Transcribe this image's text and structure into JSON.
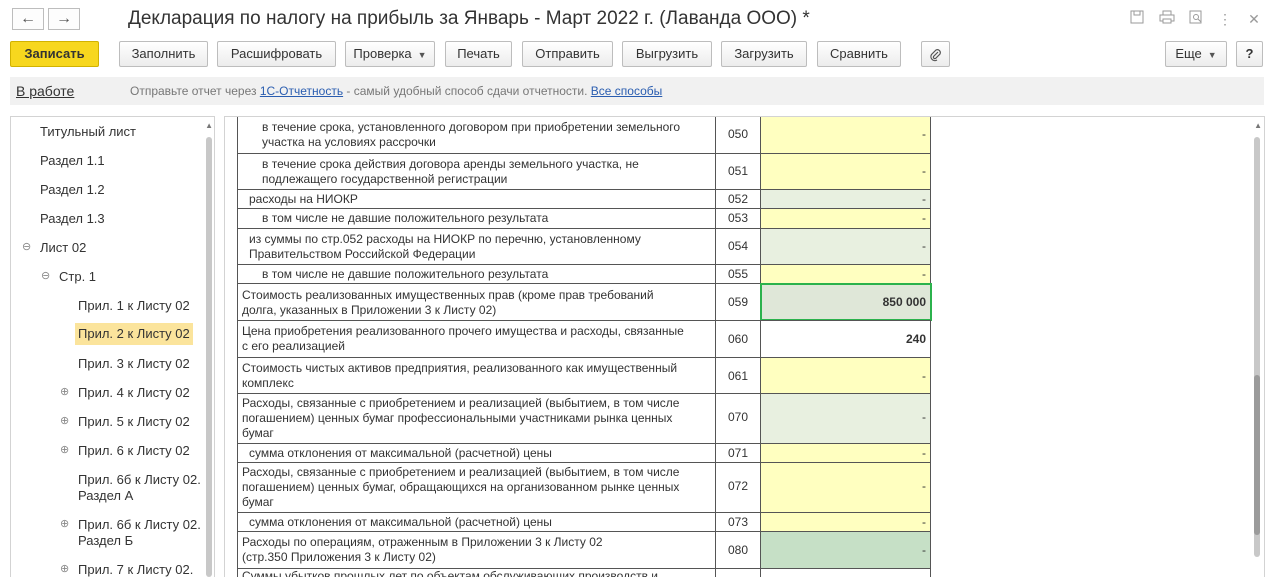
{
  "window": {
    "title": "Декларация по налогу на прибыль за Январь - Март 2022 г. (Лаванда ООО) *",
    "back_icon": "←",
    "forward_icon": "→"
  },
  "toolbar": {
    "save": "Записать",
    "fill": "Заполнить",
    "decode": "Расшифровать",
    "check": "Проверка",
    "print": "Печать",
    "send": "Отправить",
    "export": "Выгрузить",
    "import": "Загрузить",
    "compare": "Сравнить",
    "more": "Еще",
    "help": "?"
  },
  "infobar": {
    "status": "В работе",
    "text_before": "Отправьте отчет через ",
    "link1": "1С-Отчетность",
    "text_after": " - самый удобный способ сдачи отчетности. ",
    "link2": "Все способы"
  },
  "tree": [
    {
      "label": "Титульный лист"
    },
    {
      "label": "Раздел 1.1"
    },
    {
      "label": "Раздел 1.2"
    },
    {
      "label": "Раздел 1.3"
    },
    {
      "label": "Лист 02"
    },
    {
      "label": "Стр. 1"
    },
    {
      "label": "Прил. 1 к Листу 02"
    },
    {
      "label": "Прил. 2 к Листу 02"
    },
    {
      "label": "Прил. 3 к Листу 02"
    },
    {
      "label": "Прил. 4 к Листу 02"
    },
    {
      "label": "Прил. 5 к Листу 02"
    },
    {
      "label": "Прил. 6 к Листу 02"
    },
    {
      "label": "Прил. 6б к Листу 02.",
      "label2": "Раздел А"
    },
    {
      "label": "Прил. 6б к Листу 02.",
      "label2": "Раздел Б"
    },
    {
      "label": "Прил. 7 к Листу 02."
    }
  ],
  "table": {
    "rows": [
      {
        "l1": "в течение срока, установленного договором при приобретении земельного",
        "l2": "участка на условиях рассрочки",
        "code": "050",
        "value": "-"
      },
      {
        "l1": "в течение срока действия договора аренды земельного участка, не",
        "l2": "подлежащего государственной регистрации",
        "code": "051",
        "value": "-"
      },
      {
        "l1": "расходы на НИОКР",
        "code": "052",
        "value": "-"
      },
      {
        "l1": "в том числе не давшие положительного результата",
        "code": "053",
        "value": "-"
      },
      {
        "l1": "из суммы по стр.052 расходы на НИОКР по перечню, установленному",
        "l2": "Правительством Российской Федерации",
        "code": "054",
        "value": "-"
      },
      {
        "l1": "в том числе не давшие положительного результата",
        "code": "055",
        "value": "-"
      },
      {
        "l1": "Стоимость реализованных имущественных прав (кроме прав требований",
        "l2": "долга, указанных в Приложении 3 к Листу 02)",
        "code": "059",
        "value": "850 000"
      },
      {
        "l1": "Цена приобретения реализованного прочего имущества и расходы, связанные",
        "l2": "с его реализацией",
        "code": "060",
        "value": "240"
      },
      {
        "l1": "Стоимость чистых активов предприятия, реализованного как имущественный",
        "l2": "комплекс",
        "code": "061",
        "value": "-"
      },
      {
        "l1": "Расходы, связанные с приобретением и реализацией (выбытием, в том числе",
        "l2": "погашением) ценных бумаг профессиональными участниками рынка ценных",
        "l3": "бумаг",
        "code": "070",
        "value": "-"
      },
      {
        "l1": "сумма отклонения от максимальной (расчетной) цены",
        "code": "071",
        "value": "-"
      },
      {
        "l1": "Расходы, связанные с приобретением и реализацией (выбытием, в том числе",
        "l2": "погашением) ценных бумаг, обращающихся на организованном рынке ценных",
        "l3": "бумаг",
        "code": "072",
        "value": "-"
      },
      {
        "l1": "сумма отклонения от максимальной (расчетной) цены",
        "code": "073",
        "value": "-"
      },
      {
        "l1": "Расходы по операциям, отраженным в Приложении 3 к Листу 02",
        "l2": "(стр.350 Приложения 3 к Листу 02)",
        "code": "080",
        "value": "-"
      },
      {
        "l1": "Суммы убытков прошлых лет по объектам обслуживающих производств и",
        "code": "",
        "value": ""
      }
    ]
  }
}
